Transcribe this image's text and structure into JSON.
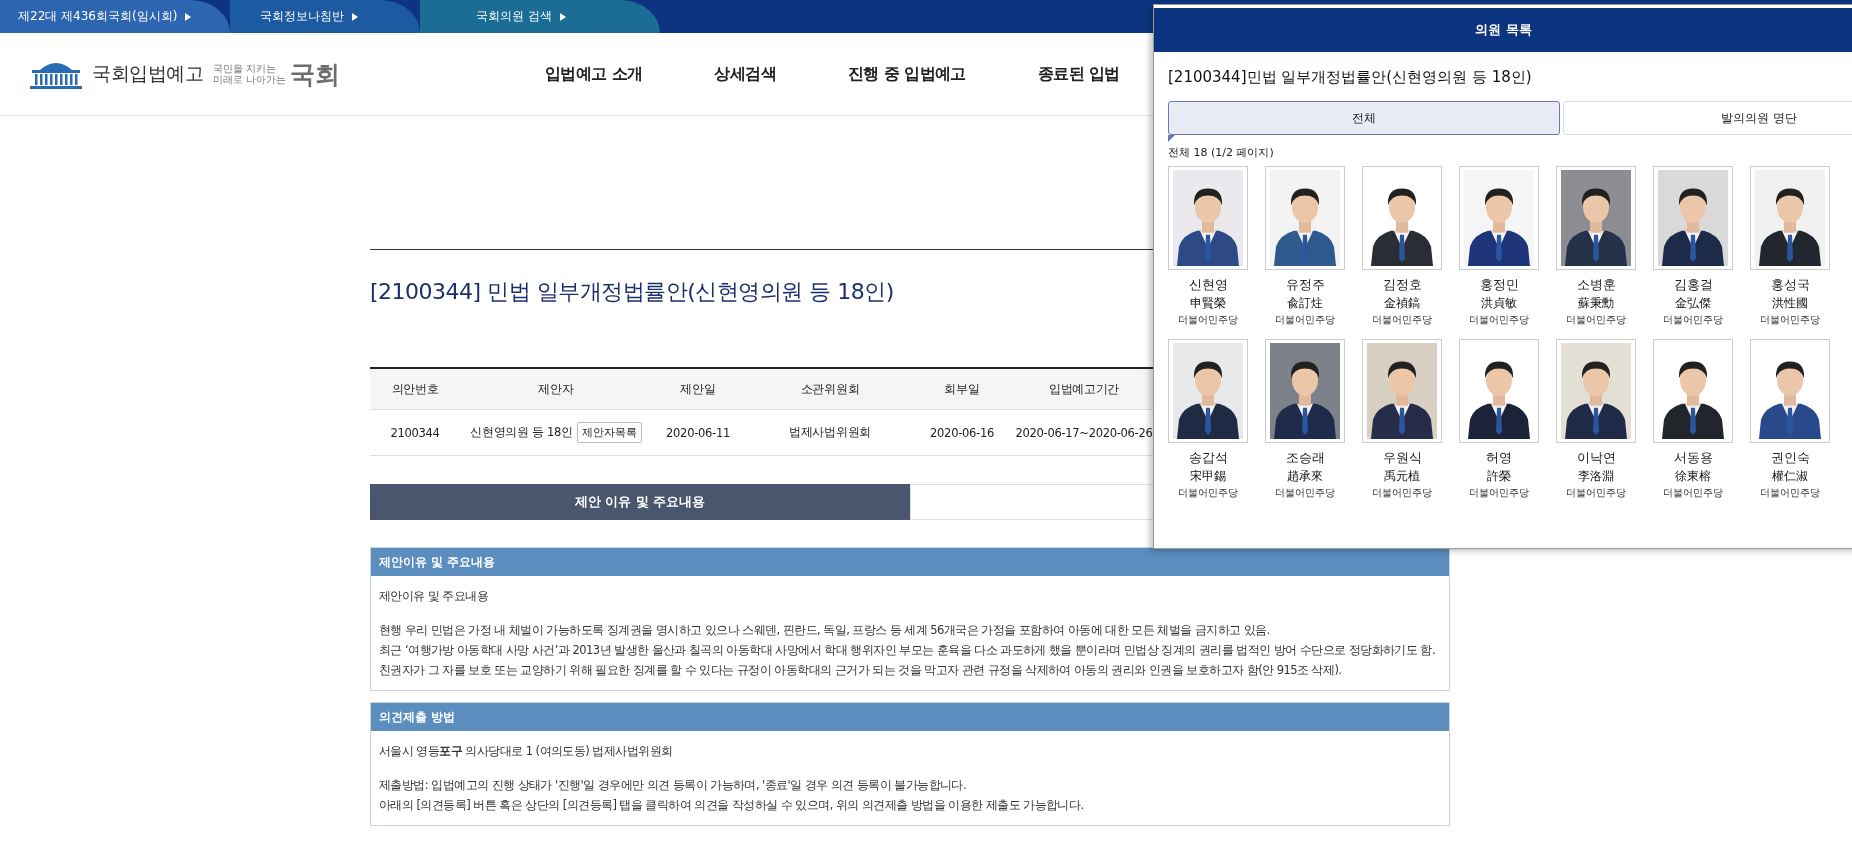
{
  "top_bar": {
    "links": [
      "제22대 제436회국회(임시회)",
      "국회정보나침반",
      "국회의원 검색"
    ]
  },
  "header": {
    "logo": {
      "title": "국회입법예고",
      "slogan": [
        "국민을 지키는",
        "미래로 나아가는"
      ],
      "mark": "국회"
    },
    "nav": [
      "입법예고 소개",
      "상세검색",
      "진행 중 입법예고",
      "종료된 입법"
    ]
  },
  "bill": {
    "title": "[2100344] 민법 일부개정법률안(신현영의원 등 18인)",
    "table": {
      "columns": [
        "의안번호",
        "제안자",
        "제안일",
        "소관위원회",
        "회부일",
        "입법예고기간"
      ],
      "rows": [
        {
          "cells": [
            "2100344",
            "신현영의원 등 18인",
            "2020-06-11",
            "법제사법위원회",
            "2020-06-16",
            "2020-06-17~2020-06-26"
          ],
          "proposer_button": "제안자목록"
        }
      ]
    },
    "tabs": [
      {
        "label": "제안 이유 및 주요내용",
        "selected": true
      },
      {
        "selected": false
      }
    ],
    "sections": [
      {
        "title": "제안이유 및 주요내용",
        "paragraphs": [
          [
            "제안이유 및 주요내용"
          ],
          [
            "현행 우리 민법은 가정 내 체벌이 가능하도록 징계권을 명시하고 있으나 스웨덴, 핀란드, 독일, 프랑스 등 세계 56개국은 가정을 포함하여 아동에 대한 모든 체벌을 금지하고 있음.",
            "최근 ‘여행가방 아동학대 사망 사건’과 2013년 발생한 울산과 칠곡의 아동학대 사망에서 학대 행위자인 부모는 훈육을 다소 과도하게 했을 뿐이라며 민법상 징계의 권리를 법적인 방어 수단으로 정당화하기도 함.",
            "친권자가 그 자를 보호 또는 교양하기 위해 필요한 징계를 할 수 있다는 규정이 아동학대의 근거가 되는 것을 막고자 관련 규정을 삭제하여 아동의 권리와 인권을 보호하고자 함(안 915조 삭제)."
          ]
        ]
      },
      {
        "title": "의견제출 방법",
        "paragraphs": [
          [
            "서울시 영등**포구** 의사당대로 1 (여의도동) 법제사법위원회"
          ],
          [
            "제출방법: 입법예고의 진행 상태가 '진행'일 경우에만 의견 등록이 가능하며, '종료'일 경우 의견 등록이 불가능합니다.",
            "아래의 [의견등록] 버튼 혹은 상단의 [의견등록] 탭을 클릭하여 의견을 작성하실 수 있으며, 위의 의견제출 방법을 이용한 제출도 가능합니다."
          ]
        ]
      }
    ]
  },
  "popup": {
    "title": "의원 목록",
    "bill_title": "[2100344]민법 일부개정법률안(신현영의원 등 18인)",
    "tabs": [
      {
        "label": "전체",
        "selected": true
      },
      {
        "label": "발의의원 명단",
        "selected": false
      }
    ],
    "count": "전체 18 (1/2 페이지)",
    "members": [
      {
        "name": "신현영",
        "hanja": "申賢榮",
        "party": "더불어민주당"
      },
      {
        "name": "유정주",
        "hanja": "兪訂炷",
        "party": "더불어민주당"
      },
      {
        "name": "김정호",
        "hanja": "金禎鎬",
        "party": "더불어민주당"
      },
      {
        "name": "홍정민",
        "hanja": "洪貞敏",
        "party": "더불어민주당"
      },
      {
        "name": "소병훈",
        "hanja": "蘇秉勳",
        "party": "더불어민주당"
      },
      {
        "name": "김홍걸",
        "hanja": "金弘傑",
        "party": "더불어민주당"
      },
      {
        "name": "홍성국",
        "hanja": "洪性國",
        "party": "더불어민주당"
      },
      {
        "name": "송갑석",
        "hanja": "宋甲錫",
        "party": "더불어민주당"
      },
      {
        "name": "조승래",
        "hanja": "趙承來",
        "party": "더불어민주당"
      },
      {
        "name": "우원식",
        "hanja": "禹元植",
        "party": "더불어민주당"
      },
      {
        "name": "허영",
        "hanja": "許榮",
        "party": "더불어민주당"
      },
      {
        "name": "이낙연",
        "hanja": "李洛淵",
        "party": "더불어민주당"
      },
      {
        "name": "서동용",
        "hanja": "徐東榕",
        "party": "더불어민주당"
      },
      {
        "name": "권인숙",
        "hanja": "權仁淑",
        "party": "더불어민주당"
      }
    ]
  }
}
